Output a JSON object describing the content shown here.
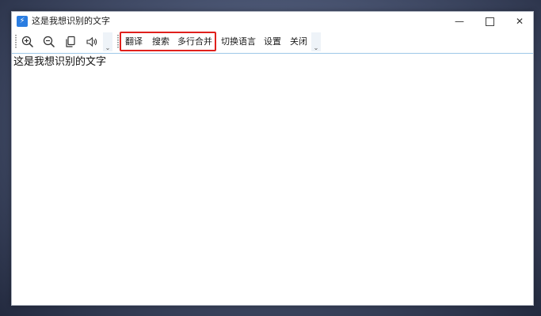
{
  "window": {
    "title": "这是我想识别的文字",
    "app_icon": "lightning-icon",
    "controls": {
      "minimize": "—",
      "close": "✕"
    }
  },
  "toolbar": {
    "icons": [
      "zoom-in-icon",
      "zoom-out-icon",
      "copy-icon",
      "speaker-icon"
    ],
    "overflow_glyph": "⌄",
    "buttons": {
      "translate": "翻译",
      "search": "搜索",
      "merge_lines": "多行合并",
      "switch_language": "切换语言",
      "settings": "设置",
      "close": "关闭"
    },
    "highlight_color": "#e0201c"
  },
  "content": {
    "text": "这是我想识别的文字"
  }
}
